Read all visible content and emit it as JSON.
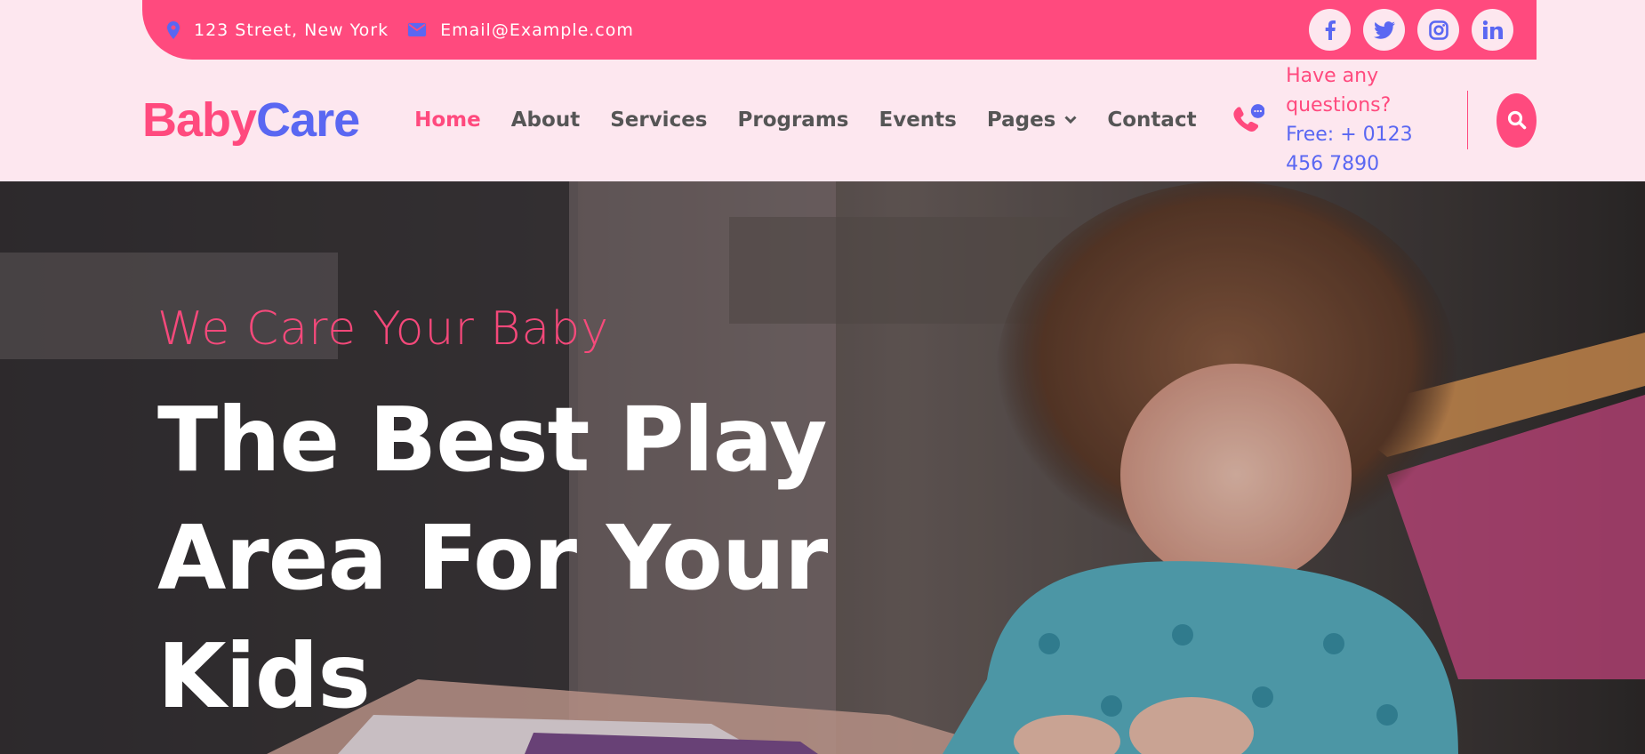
{
  "topbar": {
    "address": "123 Street, New York",
    "email": "Email@Example.com",
    "socials": [
      {
        "icon": "facebook-icon",
        "glyph": "f"
      },
      {
        "icon": "twitter-icon",
        "glyph": ""
      },
      {
        "icon": "instagram-icon",
        "glyph": ""
      },
      {
        "icon": "linkedin-icon",
        "glyph": "in"
      }
    ]
  },
  "brand": {
    "part1": "Baby",
    "part2": "Care"
  },
  "nav": {
    "items": [
      {
        "label": "Home",
        "active": true
      },
      {
        "label": "About"
      },
      {
        "label": "Services"
      },
      {
        "label": "Programs"
      },
      {
        "label": "Events"
      },
      {
        "label": "Pages",
        "dropdown": true
      },
      {
        "label": "Contact"
      }
    ]
  },
  "contact": {
    "question": "Have any questions?",
    "phone": "Free: + 0123 456 7890"
  },
  "hero": {
    "subtitle": "We Care Your Baby",
    "title_line1": "The Best Play",
    "title_line2": "Area For Your",
    "title_line3": "Kids"
  },
  "colors": {
    "primary": "#ff4a7e",
    "secondary": "#5a67f2",
    "background": "#fde7ef"
  }
}
